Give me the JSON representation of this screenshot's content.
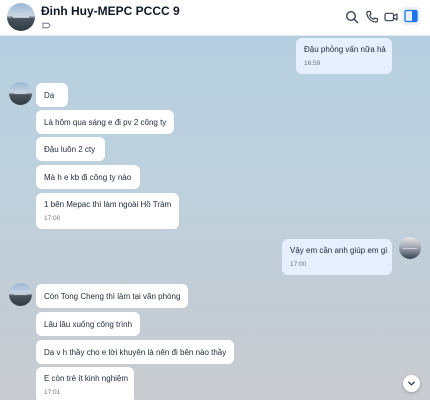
{
  "header": {
    "title": "Đinh Huy-MEPC PCCC 9",
    "icons": [
      "search-icon",
      "phone-icon",
      "video-call-icon",
      "sidebar-toggle-icon"
    ],
    "accent": "#1a73e8"
  },
  "messages": [
    {
      "direction": "out",
      "text": "Đậu phỏng vấn nữa hả",
      "time": "16:59"
    },
    {
      "direction": "in",
      "text": "Dạ"
    },
    {
      "direction": "in",
      "text": "Là hôm qua sáng e đi pv 2 công ty"
    },
    {
      "direction": "in",
      "text": "Đậu luôn 2 cty"
    },
    {
      "direction": "in",
      "text": "Mà h e kb đi công ty nào"
    },
    {
      "direction": "in",
      "text": "1 bên Mepac thì làm ngoài Hồ Tràm",
      "time": "17:00"
    },
    {
      "direction": "out",
      "text": "Vậy em cần anh giúp em gì",
      "time": "17:00"
    },
    {
      "direction": "in",
      "text": "Còn Tong Cheng thì làm tại văn phòng"
    },
    {
      "direction": "in",
      "text": "Lâu lâu xuống công trình"
    },
    {
      "direction": "in",
      "text": "Dạ v h thầy cho e lời khuyên là nên đi bên nào thầy"
    },
    {
      "direction": "in",
      "text": "E còn trẻ ít kinh nghiệm",
      "time": "17:01"
    }
  ]
}
